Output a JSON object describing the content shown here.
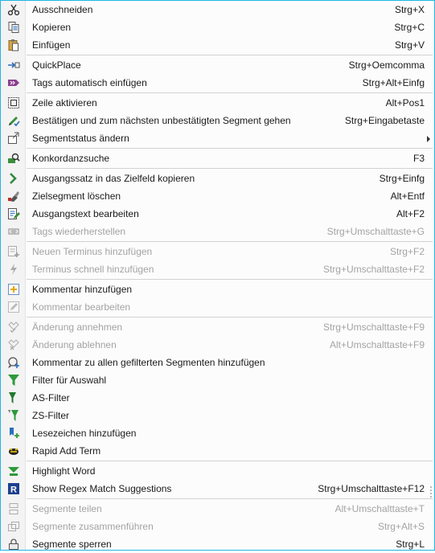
{
  "menu": {
    "items": [
      {
        "label": "Ausschneiden",
        "shortcut": "Strg+X",
        "icon": "scissors-icon"
      },
      {
        "label": "Kopieren",
        "shortcut": "Strg+C",
        "icon": "copy-icon"
      },
      {
        "label": "Einfügen",
        "shortcut": "Strg+V",
        "icon": "paste-icon"
      },
      {
        "label": "QuickPlace",
        "shortcut": "Strg+Oemcomma",
        "icon": "quickplace-icon"
      },
      {
        "label": "Tags automatisch einfügen",
        "shortcut": "Strg+Alt+Einfg",
        "icon": "auto-tags-icon"
      },
      {
        "label": "Zeile aktivieren",
        "shortcut": "Alt+Pos1",
        "icon": "activate-row-icon"
      },
      {
        "label": "Bestätigen und zum nächsten unbestätigten Segment gehen",
        "shortcut": "Strg+Eingabetaste",
        "icon": "confirm-next-icon"
      },
      {
        "label": "Segmentstatus ändern",
        "shortcut": "",
        "icon": "segment-status-icon"
      },
      {
        "label": "Konkordanzsuche",
        "shortcut": "F3",
        "icon": "concordance-icon"
      },
      {
        "label": "Ausgangssatz in das Zielfeld kopieren",
        "shortcut": "Strg+Einfg",
        "icon": "copy-source-icon"
      },
      {
        "label": "Zielsegment löschen",
        "shortcut": "Alt+Entf",
        "icon": "clear-target-icon"
      },
      {
        "label": "Ausgangstext bearbeiten",
        "shortcut": "Alt+F2",
        "icon": "edit-source-icon"
      },
      {
        "label": "Tags wiederherstellen",
        "shortcut": "Strg+Umschalttaste+G",
        "icon": "restore-tags-icon"
      },
      {
        "label": "Neuen Terminus hinzufügen",
        "shortcut": "Strg+F2",
        "icon": "add-term-icon"
      },
      {
        "label": "Terminus schnell hinzufügen",
        "shortcut": "Strg+Umschalttaste+F2",
        "icon": "quick-add-term-icon"
      },
      {
        "label": "Kommentar hinzufügen",
        "shortcut": "",
        "icon": "add-comment-icon"
      },
      {
        "label": "Kommentar bearbeiten",
        "shortcut": "",
        "icon": "edit-comment-icon"
      },
      {
        "label": "Änderung annehmen",
        "shortcut": "Strg+Umschalttaste+F9",
        "icon": "accept-change-icon"
      },
      {
        "label": "Änderung ablehnen",
        "shortcut": "Alt+Umschalttaste+F9",
        "icon": "reject-change-icon"
      },
      {
        "label": "Kommentar zu allen gefilterten Segmenten hinzufügen",
        "shortcut": "",
        "icon": "comment-filtered-icon"
      },
      {
        "label": "Filter für Auswahl",
        "shortcut": "",
        "icon": "filter-icon"
      },
      {
        "label": "AS-Filter",
        "shortcut": "",
        "icon": "source-filter-icon"
      },
      {
        "label": "ZS-Filter",
        "shortcut": "",
        "icon": "target-filter-icon"
      },
      {
        "label": "Lesezeichen hinzufügen",
        "shortcut": "",
        "icon": "bookmark-icon"
      },
      {
        "label": "Rapid Add Term",
        "shortcut": "",
        "icon": "rapid-add-term-icon"
      },
      {
        "label": "Highlight Word",
        "shortcut": "",
        "icon": "highlight-word-icon"
      },
      {
        "label": "Show Regex Match Suggestions",
        "shortcut": "Strg+Umschalttaste+F12",
        "icon": "regex-icon"
      },
      {
        "label": "Segmente teilen",
        "shortcut": "Alt+Umschalttaste+T",
        "icon": "split-segments-icon"
      },
      {
        "label": "Segmente zusammenführen",
        "shortcut": "Strg+Alt+S",
        "icon": "merge-segments-icon"
      },
      {
        "label": "Segmente sperren",
        "shortcut": "Strg+L",
        "icon": "lock-segments-icon"
      }
    ]
  }
}
